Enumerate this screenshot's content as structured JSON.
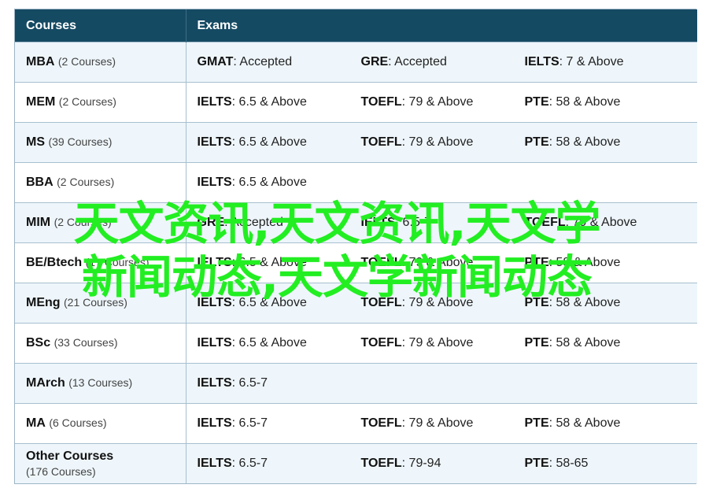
{
  "header": {
    "courses_label": "Courses",
    "exams_label": "Exams"
  },
  "rows": [
    {
      "course": "MBA",
      "count": "(2 Courses)",
      "count_below": false,
      "exams": [
        {
          "name": "GMAT",
          "score": ": Accepted"
        },
        {
          "name": "GRE",
          "score": ": Accepted"
        },
        {
          "name": "IELTS",
          "score": ": 7 & Above"
        }
      ]
    },
    {
      "course": "MEM",
      "count": "(2 Courses)",
      "count_below": false,
      "exams": [
        {
          "name": "IELTS",
          "score": ": 6.5 & Above"
        },
        {
          "name": "TOEFL",
          "score": ": 79 & Above"
        },
        {
          "name": "PTE",
          "score": ": 58 & Above"
        }
      ]
    },
    {
      "course": "MS",
      "count": "(39 Courses)",
      "count_below": false,
      "exams": [
        {
          "name": "IELTS",
          "score": ": 6.5 & Above"
        },
        {
          "name": "TOEFL",
          "score": ": 79 & Above"
        },
        {
          "name": "PTE",
          "score": ": 58 & Above"
        }
      ]
    },
    {
      "course": "BBA",
      "count": "(2 Courses)",
      "count_below": false,
      "exams": [
        {
          "name": "IELTS",
          "score": ": 6.5 & Above"
        }
      ]
    },
    {
      "course": "MIM",
      "count": "(2 Courses)",
      "count_below": false,
      "exams": [
        {
          "name": "GRE",
          "score": ": Accepted"
        },
        {
          "name": "IELTS",
          "score": ": 6.5-7"
        },
        {
          "name": "TOEFL",
          "score": ": 79 & Above"
        }
      ]
    },
    {
      "course": "BE/Btech",
      "count": "(17 Courses)",
      "count_below": false,
      "exams": [
        {
          "name": "IELTS",
          "score": ": 6.5 & Above"
        },
        {
          "name": "TOEFL",
          "score": ": 79 & Above"
        },
        {
          "name": "PTE",
          "score": ": 58 & Above"
        }
      ]
    },
    {
      "course": "MEng",
      "count": "(21 Courses)",
      "count_below": false,
      "exams": [
        {
          "name": "IELTS",
          "score": ": 6.5 & Above"
        },
        {
          "name": "TOEFL",
          "score": ": 79 & Above"
        },
        {
          "name": "PTE",
          "score": ": 58 & Above"
        }
      ]
    },
    {
      "course": "BSc",
      "count": "(33 Courses)",
      "count_below": false,
      "exams": [
        {
          "name": "IELTS",
          "score": ": 6.5 & Above"
        },
        {
          "name": "TOEFL",
          "score": ": 79 & Above"
        },
        {
          "name": "PTE",
          "score": ": 58 & Above"
        }
      ]
    },
    {
      "course": "MArch",
      "count": "(13 Courses)",
      "count_below": false,
      "exams": [
        {
          "name": "IELTS",
          "score": ": 6.5-7"
        }
      ]
    },
    {
      "course": "MA",
      "count": "(6 Courses)",
      "count_below": false,
      "exams": [
        {
          "name": "IELTS",
          "score": ": 6.5-7"
        },
        {
          "name": "TOEFL",
          "score": ": 79 & Above"
        },
        {
          "name": "PTE",
          "score": ": 58 & Above"
        }
      ]
    },
    {
      "course": "Other Courses",
      "count": "(176 Courses)",
      "count_below": true,
      "exams": [
        {
          "name": "IELTS",
          "score": ": 6.5-7"
        },
        {
          "name": "TOEFL",
          "score": ": 79-94"
        },
        {
          "name": "PTE",
          "score": ": 58-65"
        }
      ]
    }
  ],
  "watermark": {
    "line1": "天文资讯,天文资讯,天文学",
    "line2": "新闻动态,天文学新闻动态"
  },
  "colors": {
    "header_bg": "#154a63",
    "row_alt_bg": "#eef6fb",
    "watermark": "#22ee22"
  }
}
